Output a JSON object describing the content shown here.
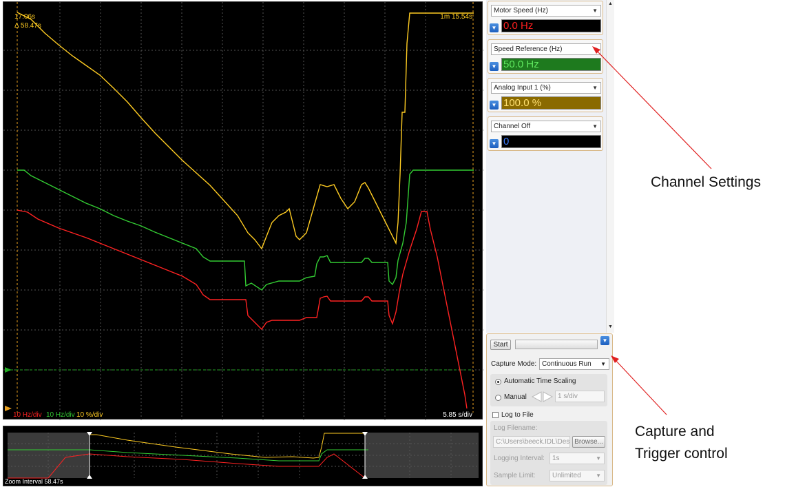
{
  "scope": {
    "cursor_time": "17.06s",
    "delta_time": "Δ 58.47s",
    "end_time": "1m 15.54s",
    "scale_red": "10 Hz/div",
    "scale_green": "10 Hz/div",
    "scale_yellow": "10 %/div",
    "time_per_div": "5.85 s/div",
    "colors": {
      "red": "#ff2222",
      "green": "#33cc33",
      "yellow": "#ffcc22",
      "grid": "#555555",
      "cursor": "#e8a020",
      "trigger": "#22aa22"
    }
  },
  "zoom": {
    "label": "Zoom Interval 58.47s"
  },
  "channels": [
    {
      "name": "Motor Speed (Hz)",
      "value": "0.0 Hz",
      "value_color": "#ff2020",
      "value_bg": "#000000"
    },
    {
      "name": "Speed Reference (Hz)",
      "value": "50.0 Hz",
      "value_color": "#5fe85f",
      "value_bg": "#1e7a1e"
    },
    {
      "name": "Analog Input 1 (%)",
      "value": "100.0 %",
      "value_color": "#ffe070",
      "value_bg": "#8a6a00"
    },
    {
      "name": "Channel Off",
      "value": "0",
      "value_color": "#3a7bff",
      "value_bg": "#000000"
    }
  ],
  "capture": {
    "start_label": "Start",
    "capture_mode_label": "Capture Mode:",
    "capture_mode_value": "Continuous Run",
    "auto_scaling_label": "Automatic Time Scaling",
    "manual_label": "Manual",
    "manual_value": "1 s/div",
    "log_to_file_label": "Log to File",
    "log_filename_label": "Log Filename:",
    "log_filename_value": "C:\\Users\\beeck.IDL\\Des",
    "browse_label": "Browse...",
    "logging_interval_label": "Logging Interval:",
    "logging_interval_value": "1s",
    "sample_limit_label": "Sample Limit:",
    "sample_limit_value": "Unlimited"
  },
  "annotations": {
    "channel_settings": "Channel Settings",
    "capture_line1": "Capture and",
    "capture_line2": "Trigger control"
  }
}
